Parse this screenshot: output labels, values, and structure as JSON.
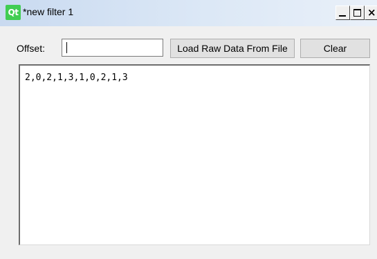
{
  "window": {
    "app_icon_label": "Qt",
    "title": "*new filter 1",
    "controls": {
      "minimize": "minimize-icon",
      "maximize": "maximize-icon",
      "close_glyph": "×"
    }
  },
  "toolbar": {
    "offset_label": "Offset:",
    "offset_value": "",
    "load_button_label": "Load Raw Data From File",
    "clear_button_label": "Clear"
  },
  "editor": {
    "content": "2,0,2,1,3,1,0,2,1,3"
  },
  "colors": {
    "titlebar_start": "#c9daf0",
    "qt_brand": "#41cd52",
    "window_bg": "#f0f0f0"
  }
}
